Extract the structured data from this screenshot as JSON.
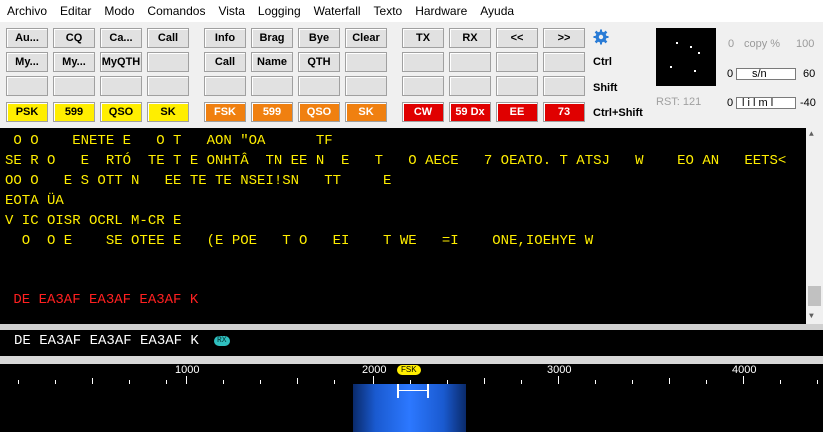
{
  "menu": [
    "Archivo",
    "Editar",
    "Modo",
    "Comandos",
    "Vista",
    "Logging",
    "Waterfall",
    "Texto",
    "Hardware",
    "Ayuda"
  ],
  "buttons": {
    "g1_row1": [
      "Au...",
      "CQ",
      "Ca...",
      "Call"
    ],
    "g1_row2": [
      "My...",
      "My...",
      "MyQTH",
      ""
    ],
    "g1_row3": [
      "",
      "",
      "",
      ""
    ],
    "g1_row4": [
      "PSK",
      "599",
      "QSO",
      "SK"
    ],
    "g2_row1": [
      "Info",
      "Brag",
      "Bye",
      "Clear"
    ],
    "g2_row2": [
      "Call",
      "Name",
      "QTH",
      ""
    ],
    "g2_row3": [
      "",
      "",
      "",
      ""
    ],
    "g2_row4": [
      "FSK",
      "599",
      "QSO",
      "SK"
    ],
    "g3_row1": [
      "TX",
      "RX",
      "<<",
      ">>"
    ],
    "g3_row2": [
      "",
      "",
      "",
      ""
    ],
    "g3_row3": [
      "",
      "",
      "",
      ""
    ],
    "g3_row4": [
      "CW",
      "59 Dx",
      "EE",
      "73"
    ]
  },
  "row_labels": [
    "Ctrl",
    "Shift",
    "Ctrl+Shift"
  ],
  "meters": {
    "copy": {
      "left": "0",
      "label": "copy %",
      "right": "100"
    },
    "sn": {
      "left": "0",
      "label": "s/n",
      "right": "60"
    },
    "ilim": {
      "left": "0",
      "label": "l i l m l",
      "right": "-40"
    }
  },
  "rst": "RST: 121",
  "rx_lines": [
    " O O    ENETE E   O T   AON \"OA      TF",
    "SE R O   E  RTÓ  TE T E ONHTÂ  TN EE N  E   T   O AECE   7 OEATO. T ATSJ   W    EO AN   EETS<",
    "OO O   E S OTT N   EE TE TE NSEI!SN   TT     E",
    "EOTA ÜA",
    "V IC OISR OCRL M-CR E",
    "  O  O E    SE OTEE E   (E POE   T O   EI    T WE   =I    ONE,IOEHYE W",
    "",
    "",
    " DE EA3AF EA3AF EA3AF K"
  ],
  "tx_text": "DE EA3AF EA3AF EA3AF K",
  "tx_badge": "RX",
  "scale_labels": [
    "1000",
    "2000",
    "3000",
    "4000"
  ],
  "fsk_badge": "FSK",
  "colors": {
    "rx_text": "#ffee00",
    "rx_tx_echo": "#ff2020",
    "psk_row": "#ffee00",
    "fsk_row": "#f08010",
    "cw_row": "#e00000"
  }
}
